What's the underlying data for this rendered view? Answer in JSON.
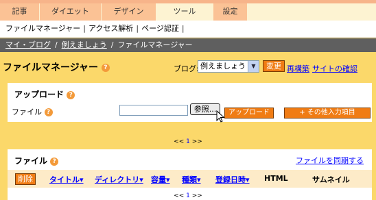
{
  "tabs": [
    "記事",
    "ダイエット",
    "デザイン",
    "ツール",
    "設定"
  ],
  "subnav": {
    "items": [
      "ファイルマネージャー",
      "アクセス解析",
      "ページ認証"
    ],
    "separator": "|"
  },
  "breadcrumb": {
    "items": [
      "マイ・ブログ",
      "例えましょう",
      "ファイルマネージャー"
    ],
    "separator": "/"
  },
  "header": {
    "title": "ファイルマネージャー",
    "blog_label": "ブログ:",
    "blog_selected": "例えましょう",
    "change_button": "変更",
    "rebuild_link": "再構築",
    "view_site_link": "サイトの確認"
  },
  "upload": {
    "title": "アップロード",
    "file_label": "ファイル",
    "browse_button": "参照...",
    "upload_button": "アップロード",
    "other_fields_button": "+ その他入力項目"
  },
  "pager_top": {
    "prev": "<<",
    "page": "1",
    "next": ">>"
  },
  "files": {
    "title": "ファイル",
    "sync_link": "ファイルを同期する",
    "delete_button": "削除",
    "columns": [
      "タイトル",
      "ディレクトリ",
      "容量",
      "種類",
      "登録日時",
      "HTML",
      "サムネイル"
    ]
  },
  "pager_bottom": {
    "prev": "<<",
    "page": "1",
    "next": ">>"
  },
  "help_glyph": "?",
  "colors": {
    "accent": "#f07c14",
    "background": "#fbd86a",
    "tab": "#fbc295",
    "breadcrumb_bar": "#5f5f5f"
  }
}
